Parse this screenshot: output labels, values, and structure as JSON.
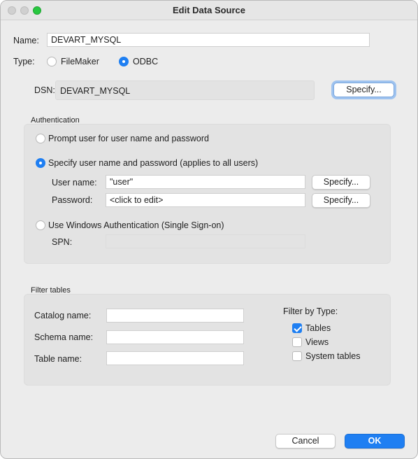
{
  "window": {
    "title": "Edit Data Source"
  },
  "name_row": {
    "label": "Name:",
    "value": "DEVART_MYSQL"
  },
  "type_row": {
    "label": "Type:",
    "options": [
      {
        "label": "FileMaker",
        "selected": false
      },
      {
        "label": "ODBC",
        "selected": true
      }
    ]
  },
  "dsn": {
    "label": "DSN:",
    "value": "DEVART_MYSQL",
    "button": "Specify..."
  },
  "authentication": {
    "title": "Authentication",
    "prompt_option": "Prompt user for user name and password",
    "specify_option": "Specify user name and password (applies to all users)",
    "username_label": "User name:",
    "username_value": "\"user\"",
    "username_button": "Specify...",
    "password_label": "Password:",
    "password_value": "<click to edit>",
    "password_button": "Specify...",
    "windows_option": "Use Windows Authentication (Single Sign-on)",
    "spn_label": "SPN:",
    "spn_value": ""
  },
  "filter_tables": {
    "title": "Filter tables",
    "catalog_label": "Catalog name:",
    "schema_label": "Schema name:",
    "table_label": "Table name:",
    "catalog_value": "",
    "schema_value": "",
    "table_value": "",
    "filter_by_type_label": "Filter by Type:",
    "types": [
      {
        "label": "Tables",
        "checked": true
      },
      {
        "label": "Views",
        "checked": false
      },
      {
        "label": "System tables",
        "checked": false
      }
    ]
  },
  "footer": {
    "cancel": "Cancel",
    "ok": "OK"
  },
  "colors": {
    "accent": "#1f7ff2",
    "window_bg": "#ececec",
    "group_bg": "#e3e3e3"
  }
}
